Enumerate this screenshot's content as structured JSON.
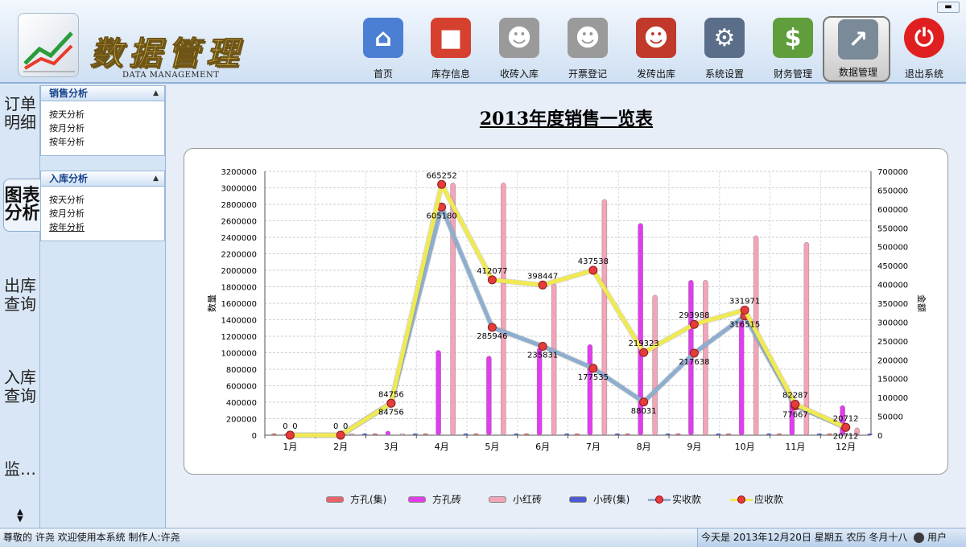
{
  "header": {
    "title_cn": "数据管理",
    "title_en": "DATA MANAGEMENT",
    "close_glyph": "▬"
  },
  "toolbar": [
    {
      "label": "首页",
      "icon": "house-icon",
      "glyph": "⌂",
      "color": "#4a7fd4"
    },
    {
      "label": "库存信息",
      "icon": "boxes-icon",
      "glyph": "■",
      "color": "#d6402e"
    },
    {
      "label": "收砖入库",
      "icon": "worker-bricks-in-icon",
      "glyph": "☻",
      "color": "#9a9a9a"
    },
    {
      "label": "开票登记",
      "icon": "worker-invoice-icon",
      "glyph": "☻",
      "color": "#9a9a9a"
    },
    {
      "label": "发砖出库",
      "icon": "wheelbarrow-icon",
      "glyph": "☻",
      "color": "#c0392b"
    },
    {
      "label": "系统设置",
      "icon": "gear-icon",
      "glyph": "⚙",
      "color": "#5a6e8a"
    },
    {
      "label": "财务管理",
      "icon": "money-notepad-icon",
      "glyph": "$",
      "color": "#5f9e3b"
    },
    {
      "label": "数据管理",
      "icon": "chart-icon",
      "glyph": "↗",
      "color": "#7a8a99",
      "active": true
    },
    {
      "label": "退出系统",
      "icon": "power-icon",
      "glyph": "⏻",
      "color": "#e02020"
    }
  ],
  "left_tabs": [
    "订单明细",
    "图表分析",
    "出库查询",
    "入库查询",
    "监…"
  ],
  "panels": [
    {
      "title": "销售分析",
      "items": [
        "按天分析",
        "按月分析",
        "按年分析"
      ]
    },
    {
      "title": "入库分析",
      "items": [
        "按天分析",
        "按月分析",
        "按年分析"
      ]
    }
  ],
  "chart_data": {
    "type": "bar",
    "title": "2013年度销售一览表",
    "categories": [
      "1月",
      "2月",
      "3月",
      "4月",
      "5月",
      "6月",
      "7月",
      "8月",
      "9月",
      "10月",
      "11月",
      "12月"
    ],
    "ylabel_left": "数量",
    "ylabel_right": "金额",
    "ylim_left": [
      0,
      3200000
    ],
    "ylim_right": [
      0,
      700000
    ],
    "yticks_left": [
      "3200000",
      "3000000",
      "2800000",
      "2600000",
      "2400000",
      "2200000",
      "2000000",
      "1800000",
      "1600000",
      "1400000",
      "1200000",
      "1000000",
      "800000",
      "600000",
      "400000",
      "200000",
      "0"
    ],
    "yticks_right": [
      "700000",
      "650000",
      "600000",
      "550000",
      "500000",
      "450000",
      "400000",
      "350000",
      "300000",
      "250000",
      "200000",
      "150000",
      "100000",
      "50000",
      "0"
    ],
    "grid": true,
    "legend": "bottom",
    "series": [
      {
        "name": "方孔(集)",
        "axis": "left",
        "type": "bar",
        "color": "#e8636b",
        "values": [
          0,
          0,
          0,
          0,
          0,
          0,
          0,
          0,
          0,
          0,
          0,
          0
        ]
      },
      {
        "name": "方孔砖",
        "axis": "left",
        "type": "bar",
        "color": "#e23cf0",
        "values": [
          0,
          0,
          50000,
          1030000,
          960000,
          1060000,
          1100000,
          2570000,
          1880000,
          1400000,
          490000,
          360000
        ]
      },
      {
        "name": "小红砖",
        "axis": "left",
        "type": "bar",
        "color": "#f3a4b8",
        "values": [
          0,
          0,
          0,
          3060000,
          3060000,
          1840000,
          2860000,
          1700000,
          1880000,
          2420000,
          2340000,
          90000
        ]
      },
      {
        "name": "小砖(集)",
        "axis": "left",
        "type": "bar",
        "color": "#4a5bd6",
        "values": [
          0,
          0,
          0,
          0,
          0,
          0,
          0,
          0,
          0,
          0,
          0,
          0
        ]
      },
      {
        "name": "实收款",
        "axis": "right",
        "type": "line",
        "color": "#8eaed0",
        "values": [
          0,
          0,
          84756,
          605180,
          285946,
          235831,
          177535,
          88031,
          217638,
          316515,
          77667,
          20712
        ]
      },
      {
        "name": "应收款",
        "axis": "right",
        "type": "line",
        "color": "#f0ea52",
        "values": [
          0,
          0,
          84756,
          665252,
          412077,
          398447,
          437538,
          219323,
          293988,
          331971,
          82287,
          20712
        ]
      }
    ]
  },
  "status": {
    "left": "尊敬的 许尧 欢迎使用本系统    制作人:许尧",
    "right": "今天是 2013年12月20日 星期五   农历 冬月十八",
    "user": "用户"
  }
}
